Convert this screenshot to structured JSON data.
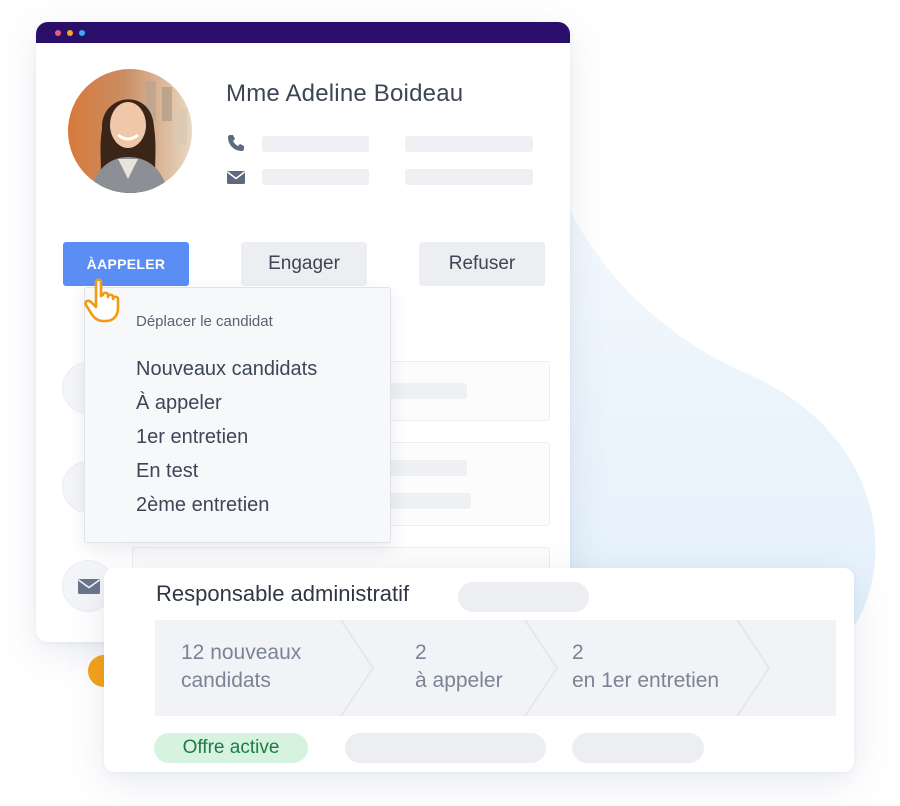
{
  "candidate": {
    "name": "Mme Adeline Boideau",
    "phone_icon": "phone-icon",
    "email_icon": "envelope-icon"
  },
  "actions": {
    "call_label": "ÀAPPELER",
    "engage_label": "Engager",
    "refuse_label": "Refuser"
  },
  "move_menu": {
    "title": "Déplacer le candidat",
    "items": [
      "Nouveaux candidats",
      "À appeler",
      "1er entretien",
      "En test",
      "2ème entretien"
    ]
  },
  "job": {
    "title": "Responsable administratif",
    "pipeline": [
      {
        "count": "12 nouveaux",
        "label": "candidats"
      },
      {
        "count": "2",
        "label": "à appeler"
      },
      {
        "count": "2",
        "label": "en 1er entretien"
      }
    ],
    "status_badge": "Offre active"
  },
  "colors": {
    "window_bar": "#2a0f6a",
    "primary_button": "#5b8ef5",
    "active_badge_bg": "#d5f3df",
    "active_badge_text": "#1f7a46",
    "accent_dot": "#f6a117"
  }
}
